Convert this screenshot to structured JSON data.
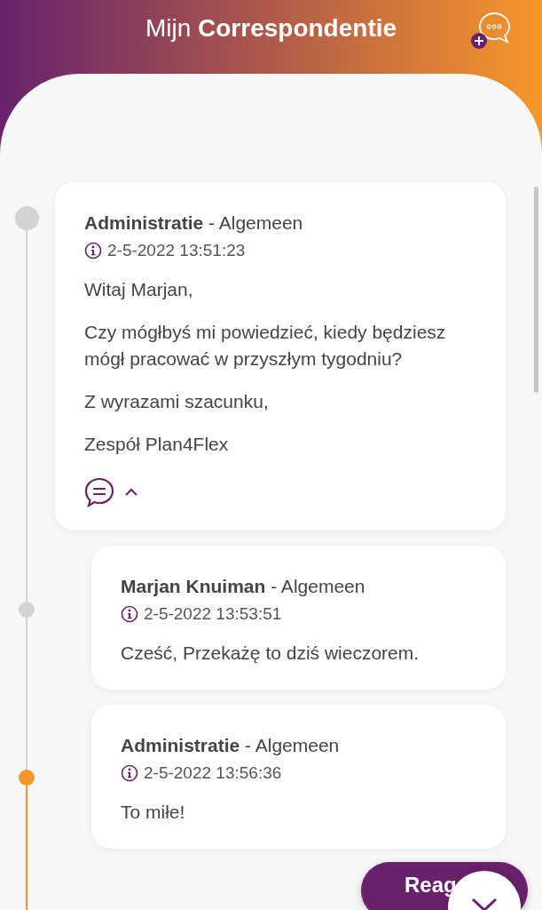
{
  "header": {
    "title": "Mijn **Correspondentie**"
  },
  "messages": [
    {
      "kind": "thread",
      "sender": "Administratie",
      "category": "- Algemeen",
      "timestamp": "2-5-2022 13:51:23",
      "paragraphs": [
        "Witaj Marjan,",
        "Czy mógłbyś mi powiedzieć, kiedy będziesz mógł pracować w przyszłym tygodniu?",
        "Z wyrazami szacunku,",
        "Zespół Plan4Flex"
      ],
      "expanded": true,
      "color": "#d3d3d3"
    },
    {
      "kind": "reply",
      "sender": "Marjan Knuiman",
      "category": "- Algemeen",
      "timestamp": "2-5-2022 13:53:51",
      "paragraphs": [
        "Cześć, Przekażę to dziś wieczorem."
      ],
      "color": "#d3d3d3"
    },
    {
      "kind": "reply",
      "sender": "Administratie",
      "category": "- Algemeen",
      "timestamp": "2-5-2022 13:56:36",
      "paragraphs": [
        "To miłe!"
      ],
      "color": "#f7972b"
    }
  ],
  "react_button": {
    "label": "Reag"
  }
}
